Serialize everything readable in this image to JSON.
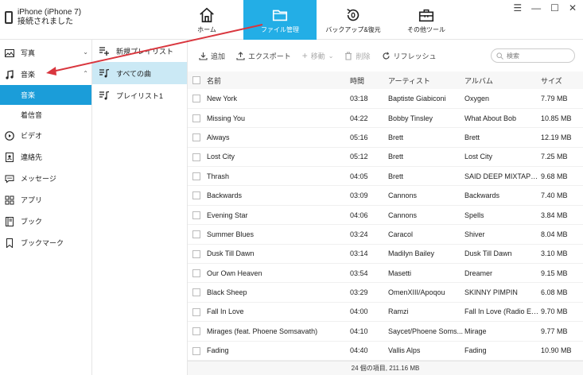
{
  "device": {
    "line1": "iPhone (iPhone 7)",
    "line2": "接続されました"
  },
  "nav": [
    {
      "label": "ホーム",
      "icon": "home-icon",
      "active": false
    },
    {
      "label": "ファイル管理",
      "icon": "folder-icon",
      "active": true
    },
    {
      "label": "バックアップ&復元",
      "icon": "backup-icon",
      "active": false
    },
    {
      "label": "その他ツール",
      "icon": "toolbox-icon",
      "active": false
    }
  ],
  "sidebar": {
    "photos": "写真",
    "music": "音楽",
    "music_sub": [
      "音楽",
      "着信音"
    ],
    "video": "ビデオ",
    "contacts": "連絡先",
    "messages": "メッセージ",
    "apps": "アプリ",
    "books": "ブック",
    "bookmarks": "ブックマーク"
  },
  "subpanel": {
    "new_playlist": "新規プレイリスト",
    "all_songs": "すべての曲",
    "playlist1": "プレイリスト1"
  },
  "toolbar": {
    "add": "追加",
    "export": "エクスポート",
    "move": "移動",
    "delete": "削除",
    "refresh": "リフレッシュ",
    "search_placeholder": "検索"
  },
  "table": {
    "headers": {
      "name": "名前",
      "time": "時間",
      "artist": "アーティスト",
      "album": "アルバム",
      "size": "サイズ"
    },
    "rows": [
      {
        "name": "New York",
        "time": "03:18",
        "artist": "Baptiste Giabiconi",
        "album": "Oxygen",
        "size": "7.79 MB"
      },
      {
        "name": "Missing You",
        "time": "04:22",
        "artist": "Bobby Tinsley",
        "album": "What About Bob",
        "size": "10.85 MB"
      },
      {
        "name": "Always",
        "time": "05:16",
        "artist": "Brett",
        "album": "Brett",
        "size": "12.19 MB"
      },
      {
        "name": "Lost City",
        "time": "05:12",
        "artist": "Brett",
        "album": "Lost City",
        "size": "7.25 MB"
      },
      {
        "name": "Thrash",
        "time": "04:05",
        "artist": "Brett",
        "album": "SAID DEEP MIXTAPE...",
        "size": "9.68 MB"
      },
      {
        "name": "Backwards",
        "time": "03:09",
        "artist": "Cannons",
        "album": "Backwards",
        "size": "7.40 MB"
      },
      {
        "name": "Evening Star",
        "time": "04:06",
        "artist": "Cannons",
        "album": "Spells",
        "size": "3.84 MB"
      },
      {
        "name": "Summer Blues",
        "time": "03:24",
        "artist": "Caracol",
        "album": "Shiver",
        "size": "8.04 MB"
      },
      {
        "name": "Dusk Till Dawn",
        "time": "03:14",
        "artist": "Madilyn Bailey",
        "album": "Dusk Till Dawn",
        "size": "3.10 MB"
      },
      {
        "name": "Our Own Heaven",
        "time": "03:54",
        "artist": "Masetti",
        "album": "Dreamer",
        "size": "9.15 MB"
      },
      {
        "name": "Black Sheep",
        "time": "03:29",
        "artist": "OmenXIII/Apoqou",
        "album": "SKINNY PIMPIN",
        "size": "6.08 MB"
      },
      {
        "name": "Fall In Love",
        "time": "04:00",
        "artist": "Ramzi",
        "album": "Fall In Love (Radio Ed...",
        "size": "9.70 MB"
      },
      {
        "name": "Mirages (feat. Phoene Somsavath)",
        "time": "04:10",
        "artist": "Saycet/Phoene Soms...",
        "album": "Mirage",
        "size": "9.77 MB"
      },
      {
        "name": "Fading",
        "time": "04:40",
        "artist": "Vallis Alps",
        "album": "Fading",
        "size": "10.90 MB"
      }
    ]
  },
  "footer": "24 個の項目, 211.16 MB",
  "colors": {
    "accent": "#23aee6",
    "accent_dark": "#1b9dd9",
    "selected_bg": "#cbe9f5",
    "annotation": "#d9363e"
  }
}
